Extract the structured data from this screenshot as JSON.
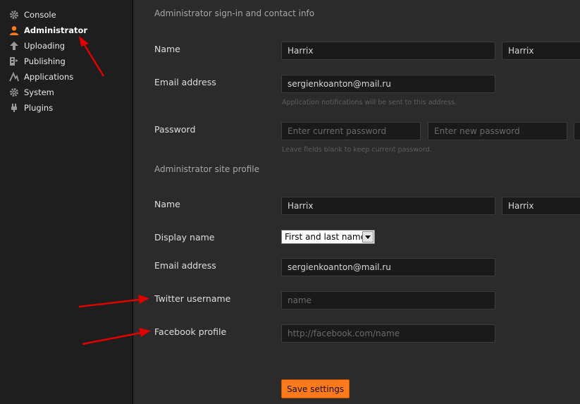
{
  "sidebar": {
    "items": [
      {
        "label": "Console",
        "icon": "gear-icon"
      },
      {
        "label": "Administrator",
        "icon": "user-icon",
        "active": true
      },
      {
        "label": "Uploading",
        "icon": "upload-arrow-icon"
      },
      {
        "label": "Publishing",
        "icon": "publishing-icon"
      },
      {
        "label": "Applications",
        "icon": "applications-icon"
      },
      {
        "label": "System",
        "icon": "gear-icon"
      },
      {
        "label": "Plugins",
        "icon": "plug-icon"
      }
    ]
  },
  "signin": {
    "title": "Administrator sign-in and contact info",
    "name_label": "Name",
    "first_name": "Harrix",
    "last_name": "Harrix",
    "email_label": "Email address",
    "email": "sergienkoanton@mail.ru",
    "email_hint": "Application notifications will be sent to this address.",
    "password_label": "Password",
    "current_password_placeholder": "Enter current password",
    "new_password_placeholder": "Enter new password",
    "password_hint": "Leave fields blank to keep current password."
  },
  "profile": {
    "title": "Administrator site profile",
    "name_label": "Name",
    "first_name": "Harrix",
    "last_name": "Harrix",
    "display_name_label": "Display name",
    "display_name_value": "First and last name",
    "email_label": "Email address",
    "email": "sergienkoanton@mail.ru",
    "twitter_label": "Twitter username",
    "twitter_placeholder": "name",
    "facebook_label": "Facebook profile",
    "facebook_placeholder": "http://facebook.com/name"
  },
  "actions": {
    "save_label": "Save settings"
  },
  "colors": {
    "accent": "#ff7a1a",
    "annotation_arrow": "#e00000",
    "sidebar_bg": "#1e1e1e",
    "main_bg": "#2b2b2b",
    "field_bg": "#1a1a1a",
    "active_icon": "#ff7a1a"
  }
}
